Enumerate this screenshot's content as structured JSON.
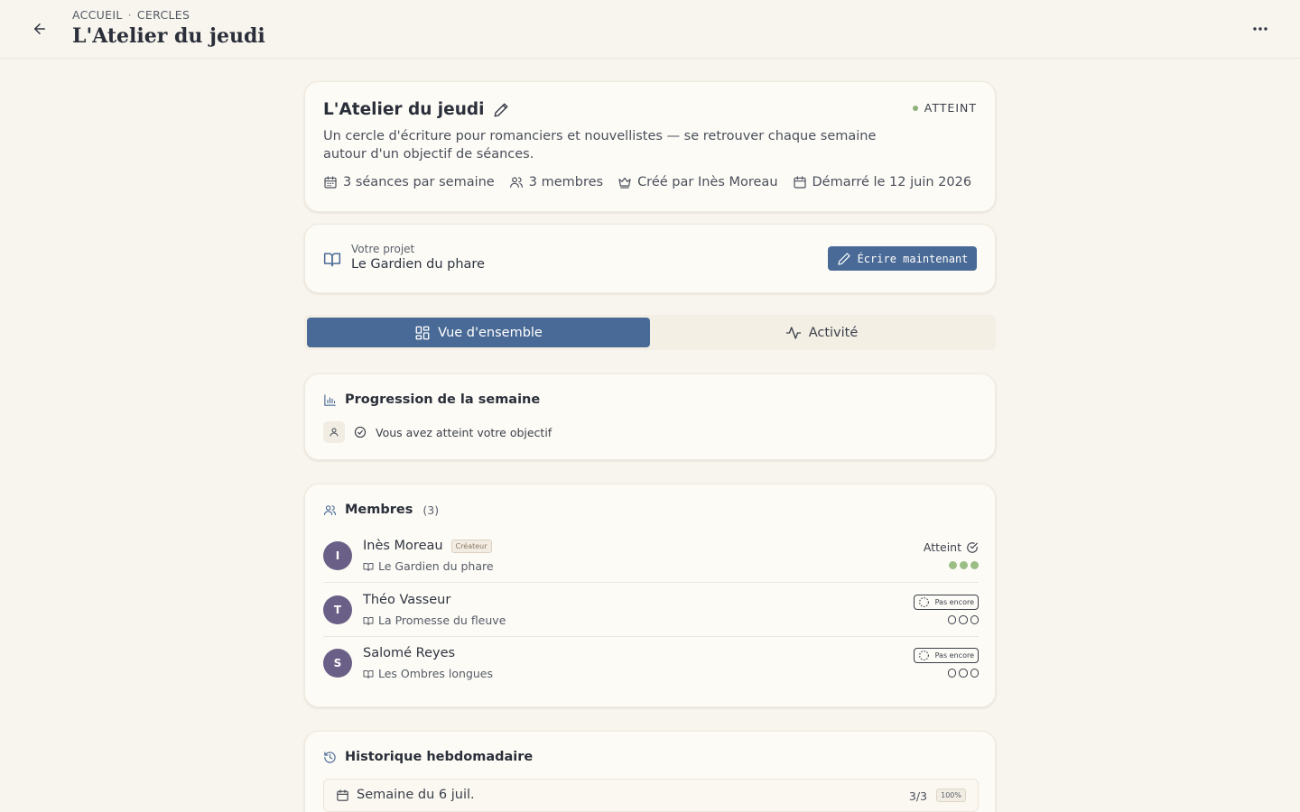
{
  "header": {
    "breadcrumb": [
      "ACCUEIL",
      "CERCLES"
    ],
    "breadcrumb_sep": "·",
    "title": "L'Atelier du jeudi"
  },
  "circle": {
    "name": "L'Atelier du jeudi",
    "status": "ATTEINT",
    "description": "Un cercle d'écriture pour romanciers et nouvellistes — se retrouver chaque semaine autour d'un objectif de séances.",
    "meta": {
      "sessions": "3 séances par semaine",
      "members": "3 membres",
      "creator": "Créé par Inès Moreau",
      "started": "Démarré le 12 juin 2026"
    }
  },
  "project": {
    "label": "Votre projet",
    "name": "Le Gardien du phare",
    "write_button": "Écrire maintenant"
  },
  "tabs": [
    {
      "label": "Vue d'ensemble",
      "active": true,
      "icon": "grid-icon"
    },
    {
      "label": "Activité",
      "active": false,
      "icon": "activity-icon"
    }
  ],
  "progress": {
    "title": "Progression de la semaine",
    "message": "Vous avez atteint votre objectif"
  },
  "members": {
    "title": "Membres",
    "count": "(3)",
    "creator_badge": "Créateur",
    "reached_label": "Atteint",
    "not_yet_label": "Pas encore",
    "list": [
      {
        "initial": "I",
        "name": "Inès Moreau",
        "book": "Le Gardien du phare",
        "is_creator": true,
        "reached": true,
        "sessions_done": 3,
        "sessions_goal": 3
      },
      {
        "initial": "T",
        "name": "Théo Vasseur",
        "book": "La Promesse du fleuve",
        "is_creator": false,
        "reached": false,
        "sessions_done": 0,
        "sessions_goal": 3
      },
      {
        "initial": "S",
        "name": "Salomé Reyes",
        "book": "Les Ombres longues",
        "is_creator": false,
        "reached": false,
        "sessions_done": 0,
        "sessions_goal": 3
      }
    ]
  },
  "history": {
    "title": "Historique hebdomadaire",
    "weeks": [
      {
        "label": "Semaine du 6 juil.",
        "score": "3/3",
        "percent": "100%"
      }
    ]
  },
  "colors": {
    "background": "#f8f5ee",
    "accent": "#496a96",
    "success": "#9bbd86",
    "avatar": "#6a5f86"
  }
}
